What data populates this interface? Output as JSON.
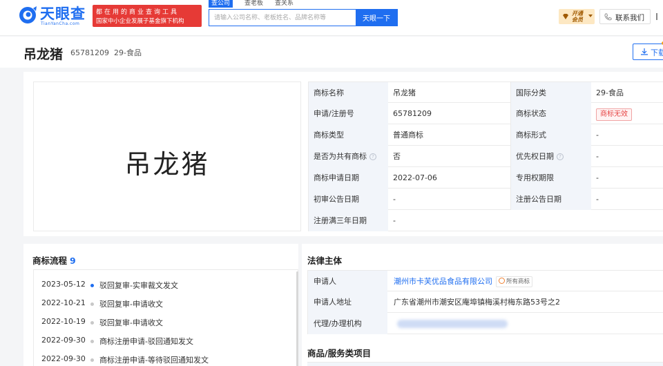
{
  "header": {
    "logo_cn": "天眼查",
    "logo_en": "TianYanCha.com",
    "slogan_line1": "都在用的商业查询工具",
    "slogan_line2": "国家中小企业发展子基金旗下机构",
    "search_tabs": [
      "查公司",
      "查老板",
      "查关系"
    ],
    "search_placeholder": "请输入公司名称、老板姓名、品牌名称等",
    "search_button": "天眼一下",
    "vip_label": "开通会员",
    "contact_label": "联系我们",
    "colors": {
      "brand": "#1f6ef0",
      "slogan_bg": "#e63a36"
    }
  },
  "trademark": {
    "name": "吊龙猪",
    "reg_no": "65781209",
    "category": "29-食品",
    "image_text": "吊龙猪",
    "download_label": "下载"
  },
  "info_table": {
    "rows": [
      {
        "l1": "商标名称",
        "v1": "吊龙猪",
        "l2": "国际分类",
        "v2": "29-食品"
      },
      {
        "l1": "申请/注册号",
        "v1": "65781209",
        "l2": "商标状态",
        "v2": "商标无效"
      },
      {
        "l1": "商标类型",
        "v1": "普通商标",
        "l2": "商标形式",
        "v2": "-"
      },
      {
        "l1": "是否为共有商标",
        "v1": "否",
        "l2": "优先权日期",
        "v2": "-"
      },
      {
        "l1": "商标申请日期",
        "v1": "2022-07-06",
        "l2": "专用权期限",
        "v2": "-"
      },
      {
        "l1": "初审公告日期",
        "v1": "-",
        "l2": "注册公告日期",
        "v2": "-"
      },
      {
        "l1": "注册满三年日期",
        "v1": "-"
      }
    ],
    "help_icon": "?"
  },
  "flow": {
    "title": "商标流程",
    "count": "9",
    "items": [
      {
        "date": "2023-05-12",
        "text": "驳回复审-实审裁文发文"
      },
      {
        "date": "2022-10-21",
        "text": "驳回复审-申请收文"
      },
      {
        "date": "2022-10-19",
        "text": "驳回复审-申请收文"
      },
      {
        "date": "2022-09-30",
        "text": "商标注册申请-驳回通知发文"
      },
      {
        "date": "2022-09-30",
        "text": "商标注册申请-等待驳回通知发文"
      }
    ]
  },
  "legal": {
    "title": "法律主体",
    "applicant_label": "申请人",
    "applicant_value": "潮州市卡芙优品食品有限公司",
    "owned_badge": "所有商标",
    "address_label": "申请人地址",
    "address_value": "广东省潮州市潮安区庵埠镇梅溪村梅东路53号之2",
    "agent_label": "代理/办理机构"
  },
  "goods": {
    "title": "商品/服务类项目"
  }
}
